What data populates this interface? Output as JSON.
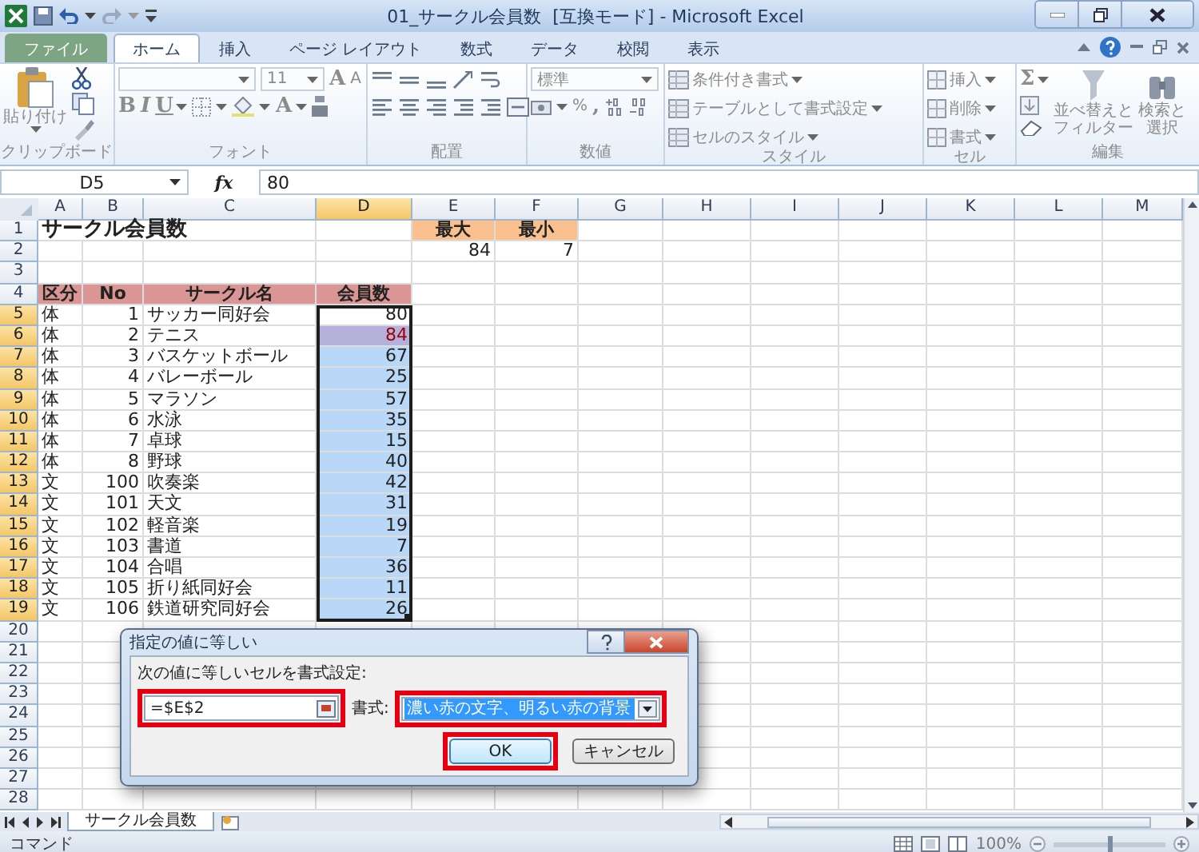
{
  "window": {
    "title": "01_サークル会員数  [互換モード] - Microsoft Excel"
  },
  "tabs": [
    {
      "label": "ファイル",
      "kind": "file",
      "selected": false
    },
    {
      "label": "ホーム",
      "kind": "tab",
      "selected": true
    },
    {
      "label": "挿入",
      "kind": "tab",
      "selected": false
    },
    {
      "label": "ページ レイアウト",
      "kind": "tab",
      "selected": false
    },
    {
      "label": "数式",
      "kind": "tab",
      "selected": false
    },
    {
      "label": "データ",
      "kind": "tab",
      "selected": false
    },
    {
      "label": "校閲",
      "kind": "tab",
      "selected": false
    },
    {
      "label": "表示",
      "kind": "tab",
      "selected": false
    }
  ],
  "ribbon": {
    "disabled": true,
    "clipboard": {
      "paste": "貼り付け",
      "label": "クリップボード"
    },
    "font": {
      "font_size": "11",
      "grow": "A",
      "shrink": "A",
      "bold": "B",
      "italic": "I",
      "underline": "U",
      "font_color": "A",
      "label": "フォント"
    },
    "alignment": {
      "label": "配置"
    },
    "number": {
      "format": "標準",
      "percent": "%",
      "comma": ",",
      "label": "数値"
    },
    "styles": {
      "items": [
        "条件付き書式",
        "テーブルとして書式設定",
        "セルのスタイル"
      ],
      "label": "スタイル"
    },
    "cells": {
      "items": [
        "挿入",
        "削除",
        "書式"
      ],
      "label": "セル"
    },
    "editing": {
      "sum": "Σ",
      "sort": [
        "並べ替えと",
        "フィルター"
      ],
      "find": [
        "検索と",
        "選択"
      ],
      "label": "編集"
    }
  },
  "formula_bar": {
    "name_box": "D5",
    "function_label": "fx",
    "formula": "80"
  },
  "sheet": {
    "columns": [
      {
        "label": "A",
        "selected": false
      },
      {
        "label": "B",
        "selected": false
      },
      {
        "label": "C",
        "selected": false
      },
      {
        "label": "D",
        "selected": true
      },
      {
        "label": "E",
        "selected": false
      },
      {
        "label": "F",
        "selected": false
      },
      {
        "label": "G",
        "selected": false
      },
      {
        "label": "H",
        "selected": false
      },
      {
        "label": "I",
        "selected": false
      },
      {
        "label": "J",
        "selected": false
      },
      {
        "label": "K",
        "selected": false
      },
      {
        "label": "L",
        "selected": false
      },
      {
        "label": "M",
        "selected": false
      }
    ],
    "rows": [
      {
        "number": "1",
        "selected": false,
        "cells": [
          {
            "kind": "title",
            "text": "サークル会員数"
          },
          {},
          {},
          {},
          {
            "kind": "header_orange",
            "text": "最大"
          },
          {
            "kind": "header_orange",
            "text": "最小"
          }
        ]
      },
      {
        "number": "2",
        "selected": false,
        "cells": [
          {},
          {},
          {},
          {},
          {
            "kind": "number",
            "text": "84"
          },
          {
            "kind": "number",
            "text": "7"
          }
        ]
      },
      {
        "number": "3",
        "selected": false
      },
      {
        "number": "4",
        "selected": false,
        "cells": [
          {
            "kind": "header_pink",
            "text": "区分"
          },
          {
            "kind": "header_pink",
            "text": "No"
          },
          {
            "kind": "header_pink",
            "text": "サークル名"
          },
          {
            "kind": "header_pink",
            "text": "会員数"
          }
        ]
      },
      {
        "number": "5",
        "selected": true,
        "cells": [
          {
            "kind": "text",
            "text": "体"
          },
          {
            "kind": "number",
            "text": "1"
          },
          {
            "kind": "text",
            "text": "サッカー同好会"
          },
          {
            "kind": "active",
            "text": "80"
          }
        ]
      },
      {
        "number": "6",
        "selected": true,
        "cells": [
          {
            "kind": "text",
            "text": "体"
          },
          {
            "kind": "number",
            "text": "2"
          },
          {
            "kind": "text",
            "text": "テニス"
          },
          {
            "kind": "highlight",
            "text": "84"
          }
        ]
      },
      {
        "number": "7",
        "selected": true,
        "cells": [
          {
            "kind": "text",
            "text": "体"
          },
          {
            "kind": "number",
            "text": "3"
          },
          {
            "kind": "text",
            "text": "バスケットボール"
          },
          {
            "kind": "selected",
            "text": "67"
          }
        ]
      },
      {
        "number": "8",
        "selected": true,
        "cells": [
          {
            "kind": "text",
            "text": "体"
          },
          {
            "kind": "number",
            "text": "4"
          },
          {
            "kind": "text",
            "text": "バレーボール"
          },
          {
            "kind": "selected",
            "text": "25"
          }
        ]
      },
      {
        "number": "9",
        "selected": true,
        "cells": [
          {
            "kind": "text",
            "text": "体"
          },
          {
            "kind": "number",
            "text": "5"
          },
          {
            "kind": "text",
            "text": "マラソン"
          },
          {
            "kind": "selected",
            "text": "57"
          }
        ]
      },
      {
        "number": "10",
        "selected": true,
        "cells": [
          {
            "kind": "text",
            "text": "体"
          },
          {
            "kind": "number",
            "text": "6"
          },
          {
            "kind": "text",
            "text": "水泳"
          },
          {
            "kind": "selected",
            "text": "35"
          }
        ]
      },
      {
        "number": "11",
        "selected": true,
        "cells": [
          {
            "kind": "text",
            "text": "体"
          },
          {
            "kind": "number",
            "text": "7"
          },
          {
            "kind": "text",
            "text": "卓球"
          },
          {
            "kind": "selected",
            "text": "15"
          }
        ]
      },
      {
        "number": "12",
        "selected": true,
        "cells": [
          {
            "kind": "text",
            "text": "体"
          },
          {
            "kind": "number",
            "text": "8"
          },
          {
            "kind": "text",
            "text": "野球"
          },
          {
            "kind": "selected",
            "text": "40"
          }
        ]
      },
      {
        "number": "13",
        "selected": true,
        "cells": [
          {
            "kind": "text",
            "text": "文"
          },
          {
            "kind": "number",
            "text": "100"
          },
          {
            "kind": "text",
            "text": "吹奏楽"
          },
          {
            "kind": "selected",
            "text": "42"
          }
        ]
      },
      {
        "number": "14",
        "selected": true,
        "cells": [
          {
            "kind": "text",
            "text": "文"
          },
          {
            "kind": "number",
            "text": "101"
          },
          {
            "kind": "text",
            "text": "天文"
          },
          {
            "kind": "selected",
            "text": "31"
          }
        ]
      },
      {
        "number": "15",
        "selected": true,
        "cells": [
          {
            "kind": "text",
            "text": "文"
          },
          {
            "kind": "number",
            "text": "102"
          },
          {
            "kind": "text",
            "text": "軽音楽"
          },
          {
            "kind": "selected",
            "text": "19"
          }
        ]
      },
      {
        "number": "16",
        "selected": true,
        "cells": [
          {
            "kind": "text",
            "text": "文"
          },
          {
            "kind": "number",
            "text": "103"
          },
          {
            "kind": "text",
            "text": "書道"
          },
          {
            "kind": "selected",
            "text": "7"
          }
        ]
      },
      {
        "number": "17",
        "selected": true,
        "cells": [
          {
            "kind": "text",
            "text": "文"
          },
          {
            "kind": "number",
            "text": "104"
          },
          {
            "kind": "text",
            "text": "合唱"
          },
          {
            "kind": "selected",
            "text": "36"
          }
        ]
      },
      {
        "number": "18",
        "selected": true,
        "cells": [
          {
            "kind": "text",
            "text": "文"
          },
          {
            "kind": "number",
            "text": "105"
          },
          {
            "kind": "text",
            "text": "折り紙同好会"
          },
          {
            "kind": "selected",
            "text": "11"
          }
        ]
      },
      {
        "number": "19",
        "selected": true,
        "cells": [
          {
            "kind": "text",
            "text": "文"
          },
          {
            "kind": "number",
            "text": "106"
          },
          {
            "kind": "text",
            "text": "鉄道研究同好会"
          },
          {
            "kind": "selected",
            "text": "26"
          }
        ]
      },
      {
        "number": "20",
        "selected": false
      },
      {
        "number": "21",
        "selected": false
      },
      {
        "number": "22",
        "selected": false
      },
      {
        "number": "23",
        "selected": false
      },
      {
        "number": "24",
        "selected": false
      },
      {
        "number": "25",
        "selected": false
      },
      {
        "number": "26",
        "selected": false
      },
      {
        "number": "27",
        "selected": false
      },
      {
        "number": "28",
        "selected": false
      }
    ]
  },
  "sheet_tabs": [
    {
      "label": "サークル会員数",
      "selected": true
    }
  ],
  "dialog": {
    "title": "指定の値に等しい",
    "prompt": "次の値に等しいセルを書式設定:",
    "value_field": {
      "value": "=$E$2",
      "marked": true
    },
    "format": {
      "label": "書式:",
      "value": "濃い赤の文字、明るい赤の背景",
      "marked": true
    },
    "buttons": [
      {
        "label": "OK",
        "default": true,
        "marked": true
      },
      {
        "label": "キャンセル",
        "default": false,
        "marked": false
      }
    ]
  },
  "status_bar": {
    "mode": "コマンド",
    "zoom": "100%",
    "zoom_slider": {
      "level": 0.5
    }
  }
}
